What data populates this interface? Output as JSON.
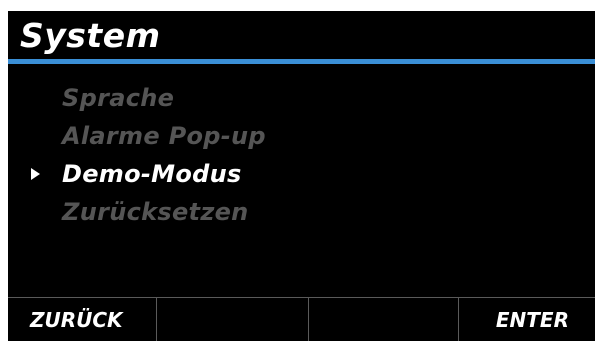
{
  "header": {
    "title": "System"
  },
  "menu": {
    "items": [
      {
        "label": "Sprache",
        "selected": false
      },
      {
        "label": "Alarme Pop-up",
        "selected": false
      },
      {
        "label": "Demo-Modus",
        "selected": true
      },
      {
        "label": "Zurücksetzen",
        "selected": false
      }
    ]
  },
  "footer": {
    "softkeys": [
      {
        "label": "ZURÜCK"
      },
      {
        "label": ""
      },
      {
        "label": ""
      },
      {
        "label": "ENTER"
      }
    ]
  },
  "colors": {
    "background": "#000000",
    "accent": "#3a8fd6",
    "text_active": "#ffffff",
    "text_inactive": "#555555",
    "divider": "#5a5a5a"
  },
  "icons": {
    "selection_pointer": "triangle-right-icon"
  }
}
